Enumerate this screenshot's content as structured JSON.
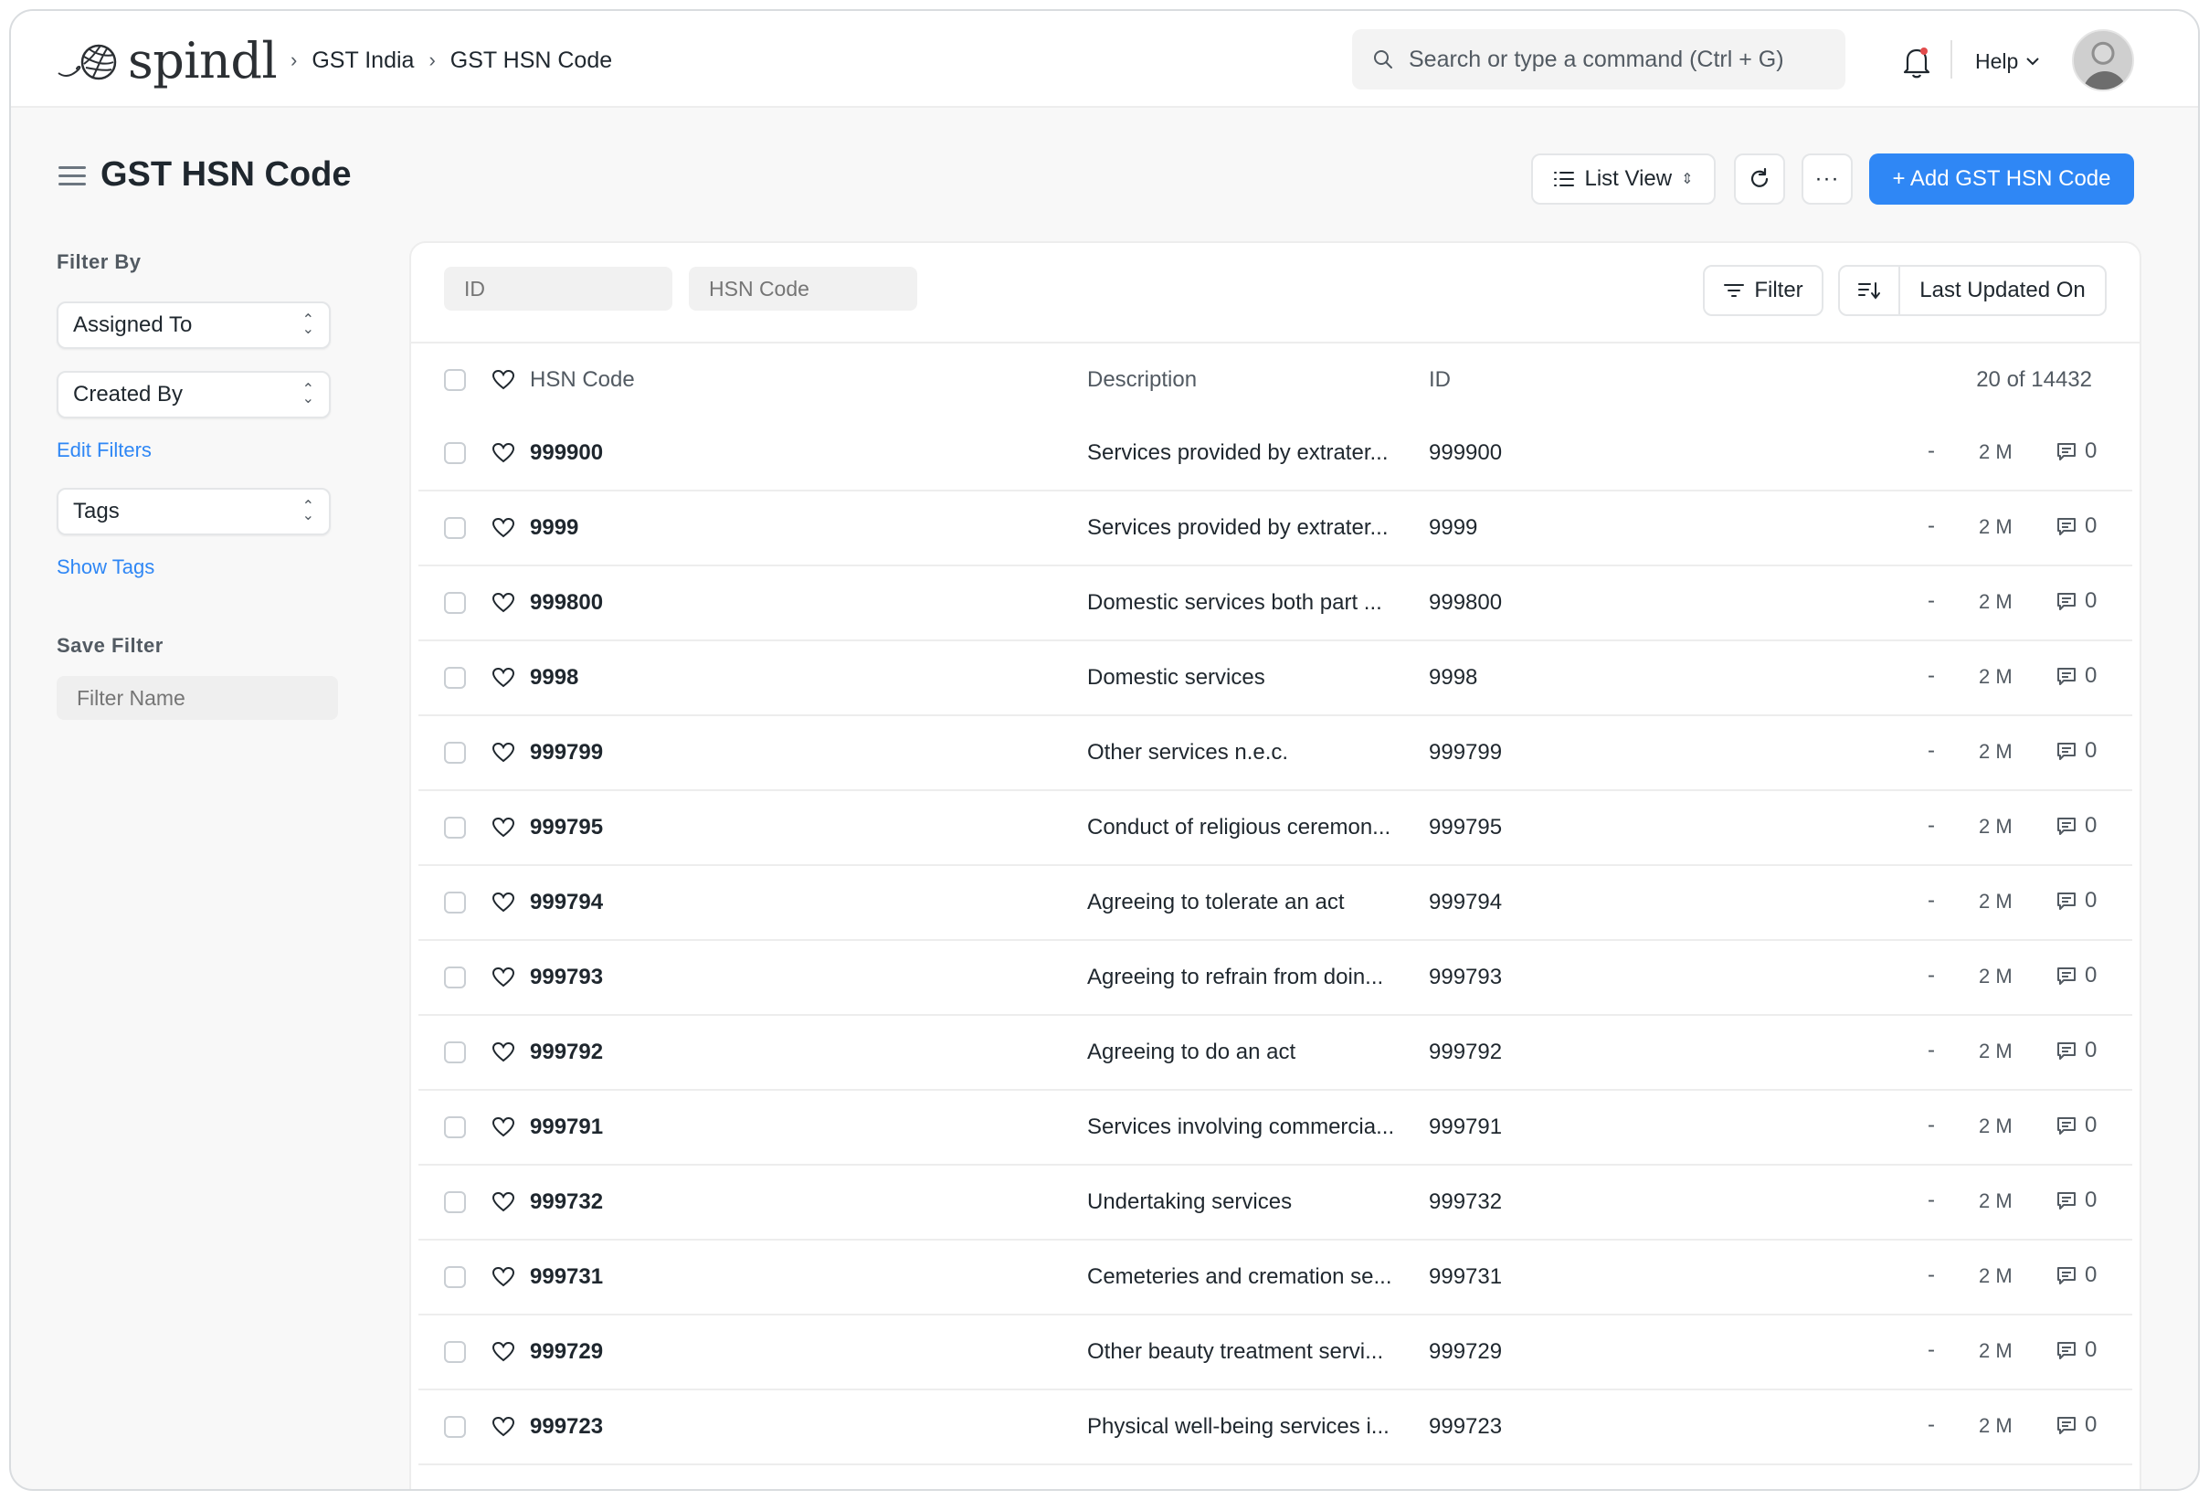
{
  "app": {
    "brand": "spindl"
  },
  "breadcrumbs": [
    "GST India",
    "GST HSN Code"
  ],
  "search": {
    "placeholder": "Search or type a command (Ctrl + G)"
  },
  "nav": {
    "help_label": "Help"
  },
  "page": {
    "title": "GST HSN Code",
    "list_view_label": "List View",
    "more_label": "···",
    "add_button_label": "+ Add GST HSN Code"
  },
  "sidebar": {
    "filter_by_label": "Filter By",
    "assigned_to_label": "Assigned To",
    "created_by_label": "Created By",
    "edit_filters_label": "Edit Filters",
    "tags_label": "Tags",
    "show_tags_label": "Show Tags",
    "save_filter_label": "Save Filter",
    "filter_name_placeholder": "Filter Name"
  },
  "list": {
    "id_filter_placeholder": "ID",
    "hsn_filter_placeholder": "HSN Code",
    "filter_button_label": "Filter",
    "sort_by_label": "Last Updated On",
    "columns": {
      "code": "HSN Code",
      "description": "Description",
      "id": "ID"
    },
    "count_label": "20 of 14432",
    "rows": [
      {
        "code": "999900",
        "description": "Services provided by extrater...",
        "id": "999900",
        "assigned": "-",
        "modified": "2 M",
        "comments": "0"
      },
      {
        "code": "9999",
        "description": "Services provided by extrater...",
        "id": "9999",
        "assigned": "-",
        "modified": "2 M",
        "comments": "0"
      },
      {
        "code": "999800",
        "description": "Domestic services both part ...",
        "id": "999800",
        "assigned": "-",
        "modified": "2 M",
        "comments": "0"
      },
      {
        "code": "9998",
        "description": "Domestic services",
        "id": "9998",
        "assigned": "-",
        "modified": "2 M",
        "comments": "0"
      },
      {
        "code": "999799",
        "description": "Other services n.e.c.",
        "id": "999799",
        "assigned": "-",
        "modified": "2 M",
        "comments": "0"
      },
      {
        "code": "999795",
        "description": "Conduct of religious ceremon...",
        "id": "999795",
        "assigned": "-",
        "modified": "2 M",
        "comments": "0"
      },
      {
        "code": "999794",
        "description": "Agreeing to tolerate an act",
        "id": "999794",
        "assigned": "-",
        "modified": "2 M",
        "comments": "0"
      },
      {
        "code": "999793",
        "description": "Agreeing to refrain from doin...",
        "id": "999793",
        "assigned": "-",
        "modified": "2 M",
        "comments": "0"
      },
      {
        "code": "999792",
        "description": "Agreeing to do an act",
        "id": "999792",
        "assigned": "-",
        "modified": "2 M",
        "comments": "0"
      },
      {
        "code": "999791",
        "description": "Services involving commercia...",
        "id": "999791",
        "assigned": "-",
        "modified": "2 M",
        "comments": "0"
      },
      {
        "code": "999732",
        "description": "Undertaking services",
        "id": "999732",
        "assigned": "-",
        "modified": "2 M",
        "comments": "0"
      },
      {
        "code": "999731",
        "description": "Cemeteries and cremation se...",
        "id": "999731",
        "assigned": "-",
        "modified": "2 M",
        "comments": "0"
      },
      {
        "code": "999729",
        "description": "Other beauty treatment servi...",
        "id": "999729",
        "assigned": "-",
        "modified": "2 M",
        "comments": "0"
      },
      {
        "code": "999723",
        "description": "Physical well-being services i...",
        "id": "999723",
        "assigned": "-",
        "modified": "2 M",
        "comments": "0"
      }
    ]
  },
  "colors": {
    "primary": "#2f87f5",
    "text": "#1f272e",
    "muted": "#525a62",
    "border": "#ededed"
  }
}
